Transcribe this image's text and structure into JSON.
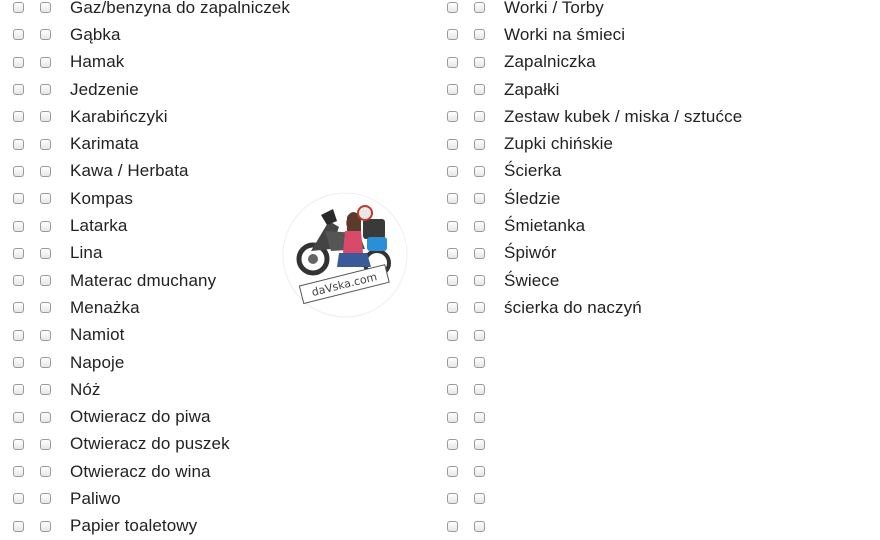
{
  "left_items": [
    "Gaz/benzyna do zapalniczek",
    "Gąbka",
    "Hamak",
    "Jedzenie",
    "Karabińczyki",
    "Karimata",
    "Kawa / Herbata",
    "Kompas",
    "Latarka",
    "Lina",
    "Materac dmuchany",
    "Menażka",
    "Namiot",
    "Napoje",
    "Nóż",
    "Otwieracz do piwa",
    "Otwieracz do puszek",
    "Otwieracz do wina",
    "Paliwo",
    "Papier toaletowy"
  ],
  "right_items": [
    "Worki / Torby",
    "Worki na śmieci",
    "Zapalniczka",
    "Zapałki",
    "Zestaw kubek / miska / sztućce",
    "Zupki chińskie",
    "Ścierka",
    "Śledzie",
    "Śmietanka",
    "Śpiwór",
    "Świece",
    "ścierka do naczyń",
    "",
    "",
    "",
    "",
    "",
    "",
    "",
    ""
  ],
  "watermark": {
    "text": "daVska.com",
    "icon": "motorcycle-rider-logo"
  },
  "colors": {
    "text": "#222222",
    "checkbox_border": "#9a9a9a",
    "logo_blue": "#2a8fd6"
  }
}
